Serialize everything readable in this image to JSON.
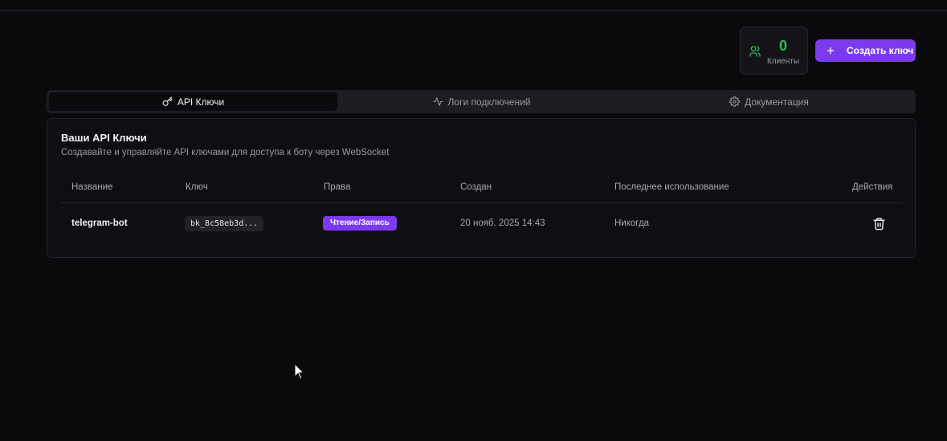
{
  "header": {
    "clients_count": "0",
    "clients_label": "Клиенты",
    "create_button_label": "Создать ключ"
  },
  "tabs": [
    {
      "label": "API Ключи",
      "icon": "key-icon",
      "active": true
    },
    {
      "label": "Логи подключений",
      "icon": "activity-icon",
      "active": false
    },
    {
      "label": "Документация",
      "icon": "gear-icon",
      "active": false
    }
  ],
  "keys_card": {
    "title": "Ваши API Ключи",
    "subtitle": "Создавайте и управляйте API ключами для доступа к боту через WebSocket",
    "columns": [
      "Название",
      "Ключ",
      "Права",
      "Создан",
      "Последнее использование",
      "Действия"
    ],
    "rows": [
      {
        "name": "telegram-bot",
        "key": "bk_8c58eb3d...",
        "permissions": "Чтение/Запись",
        "created": "20 нояб. 2025 14:43",
        "last_used": "Никогда"
      }
    ]
  },
  "colors": {
    "accent": "#7c3aed",
    "success": "#21c45d",
    "background": "#0a090c"
  }
}
